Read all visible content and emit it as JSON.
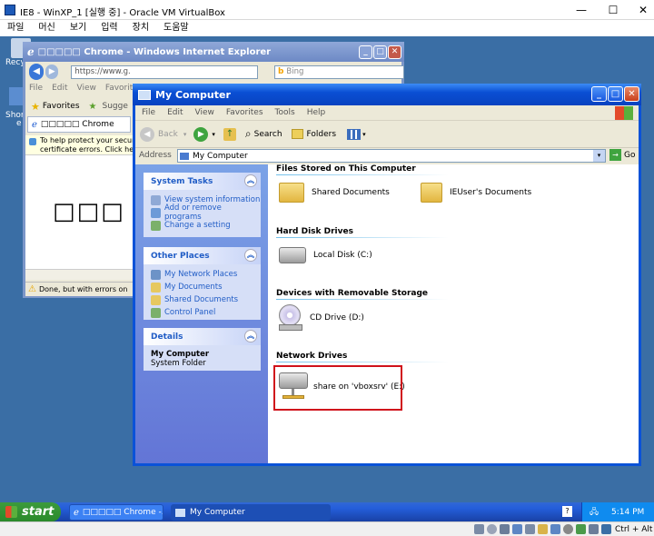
{
  "host": {
    "title": "IE8 - WinXP_1 [실행 중] - Oracle VM VirtualBox",
    "menu": [
      "파일",
      "머신",
      "보기",
      "입력",
      "장치",
      "도움말"
    ],
    "status_hostkey": "Ctrl + Alt"
  },
  "desktop": {
    "icon_label_1": "Recy",
    "icon_label_2": "Short",
    "icon_label_3": "e"
  },
  "ie": {
    "title": "□□□□□ Chrome - Windows Internet Explorer",
    "address": "https://www.g.",
    "search_placeholder": "Bing",
    "menu": [
      "File",
      "Edit",
      "View",
      "Favorites"
    ],
    "favorites_label": "Favorites",
    "sugg_label": "Sugge",
    "tab_label": "□□□□□ Chrome",
    "security_bar_1": "To help protect your security",
    "security_bar_2": "certificate errors. Click here f",
    "content_glyphs": "□□□",
    "status": "Done, but with errors on p"
  },
  "mycomputer": {
    "title": "My Computer",
    "menu": [
      "File",
      "Edit",
      "View",
      "Favorites",
      "Tools",
      "Help"
    ],
    "toolbar": {
      "back": "Back",
      "search": "Search",
      "folders": "Folders"
    },
    "address_label": "Address",
    "address_value": "My Computer",
    "go_label": "Go",
    "system_tasks": {
      "title": "System Tasks",
      "items": [
        "View system information",
        "Add or remove programs",
        "Change a setting"
      ]
    },
    "other_places": {
      "title": "Other Places",
      "items": [
        "My Network Places",
        "My Documents",
        "Shared Documents",
        "Control Panel"
      ]
    },
    "details": {
      "title": "Details",
      "name": "My Computer",
      "type": "System Folder"
    },
    "groups": {
      "files_stored": "Files Stored on This Computer",
      "shared_docs": "Shared Documents",
      "ieuser_docs": "IEUser's Documents",
      "hard_disk": "Hard Disk Drives",
      "local_disk": "Local Disk (C:)",
      "removable": "Devices with Removable Storage",
      "cd_drive": "CD Drive (D:)",
      "network": "Network Drives",
      "share": "share on 'vboxsrv' (E:)"
    }
  },
  "taskbar": {
    "start": "start",
    "task1": "□□□□□ Chrome -...",
    "task2": "My Computer",
    "clock": "5:14 PM"
  },
  "colors": {
    "xp_blue": "#0a52d8",
    "highlight_box": "#d0121b",
    "desktop": "#3a6ea5"
  }
}
